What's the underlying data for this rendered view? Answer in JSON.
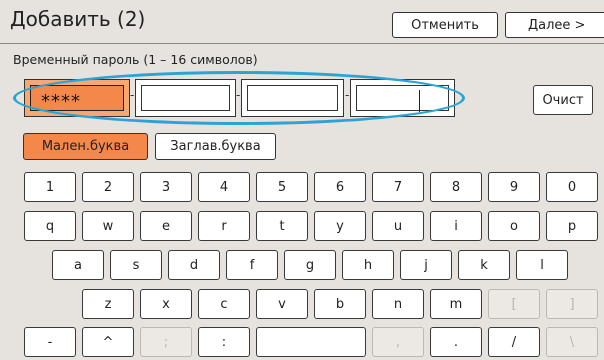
{
  "header": {
    "title": "Добавить (2)",
    "cancel_label": "Отменить",
    "next_label": "Далее >"
  },
  "password": {
    "label": "Временный пароль (1 – 16 символов)",
    "field1_value": "****",
    "clear_label": "Очист"
  },
  "modes": {
    "lower_label": "Мален.буква",
    "upper_label": "Заглав.буква"
  },
  "keyboard": {
    "row1": [
      "1",
      "2",
      "3",
      "4",
      "5",
      "6",
      "7",
      "8",
      "9",
      "0"
    ],
    "row2": [
      "q",
      "w",
      "e",
      "r",
      "t",
      "y",
      "u",
      "i",
      "o",
      "p"
    ],
    "row3": [
      "a",
      "s",
      "d",
      "f",
      "g",
      "h",
      "j",
      "k",
      "l"
    ],
    "row4": [
      "z",
      "x",
      "c",
      "v",
      "b",
      "n",
      "m",
      "[",
      "]"
    ],
    "row5": [
      "-",
      "^",
      ";",
      ":",
      "",
      ",",
      ".",
      "/",
      "\\"
    ]
  },
  "colors": {
    "accent": "#f4884a",
    "highlight": "#2aa4d5"
  }
}
